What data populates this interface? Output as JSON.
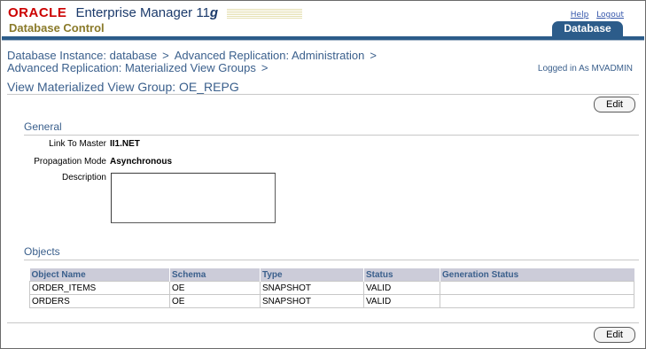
{
  "header": {
    "oracle_logo": "ORACLE",
    "app_title": "Enterprise Manager 11",
    "app_version": "g",
    "subtitle": "Database Control",
    "links": {
      "help": "Help",
      "logout": "Logout"
    },
    "tab": "Database"
  },
  "breadcrumbs": {
    "items": [
      "Database Instance: database",
      "Advanced Replication: Administration",
      "Advanced Replication: Materialized View Groups"
    ],
    "separator": ">"
  },
  "logged_in": "Logged in As MVADMIN",
  "page_title": "View Materialized View Group: OE_REPG",
  "buttons": {
    "edit_top": "Edit",
    "edit_bottom": "Edit"
  },
  "general": {
    "heading": "General",
    "link_to_master_label": "Link To Master",
    "link_to_master_value": "II1.NET",
    "propagation_mode_label": "Propagation Mode",
    "propagation_mode_value": "Asynchronous",
    "description_label": "Description",
    "description_value": ""
  },
  "objects": {
    "heading": "Objects",
    "columns": [
      "Object Name",
      "Schema",
      "Type",
      "Status",
      "Generation Status"
    ],
    "rows": [
      [
        "ORDER_ITEMS",
        "OE",
        "SNAPSHOT",
        "VALID",
        ""
      ],
      [
        "ORDERS",
        "OE",
        "SNAPSHOT",
        "VALID",
        ""
      ]
    ]
  },
  "colors": {
    "brand_red": "#cc0000",
    "tab_blue": "#2c5c8a",
    "link_blue": "#3a5f8c",
    "table_header_bg": "#ccccd9"
  }
}
